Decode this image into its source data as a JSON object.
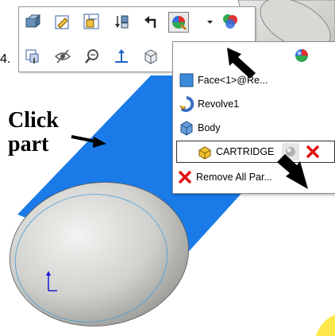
{
  "annotation": {
    "line1": "Click",
    "line2": "part"
  },
  "edge_fragment": "4.",
  "toolbar": {
    "row1": [
      "component-icon",
      "sketch-icon",
      "assembly-icon",
      "mate-icon",
      "undo-arrow-icon",
      "appearance-icon",
      "dropdown-arrow-icon",
      "appearance-colors-icon"
    ],
    "row2": [
      "move-component-icon",
      "hide-icon",
      "zoom-icon",
      "normal-to-icon",
      "view-box-icon"
    ]
  },
  "appearance_menu": {
    "items": [
      {
        "label": "Face<1>@Re...",
        "icon": "face-icon"
      },
      {
        "label": "Revolve1",
        "icon": "revolve-icon"
      },
      {
        "label": "Body",
        "icon": "body-icon"
      },
      {
        "label": "CARTRIDGE",
        "icon": "part-icon",
        "selected": true
      },
      {
        "label": "Remove All Par...",
        "icon": "remove-x-icon"
      }
    ],
    "header_icon": "appearance-ball-icon"
  },
  "colors": {
    "part_blue": "#1a7be8",
    "cap_gray": "#c9c9c6",
    "remove_red": "#e01010"
  }
}
